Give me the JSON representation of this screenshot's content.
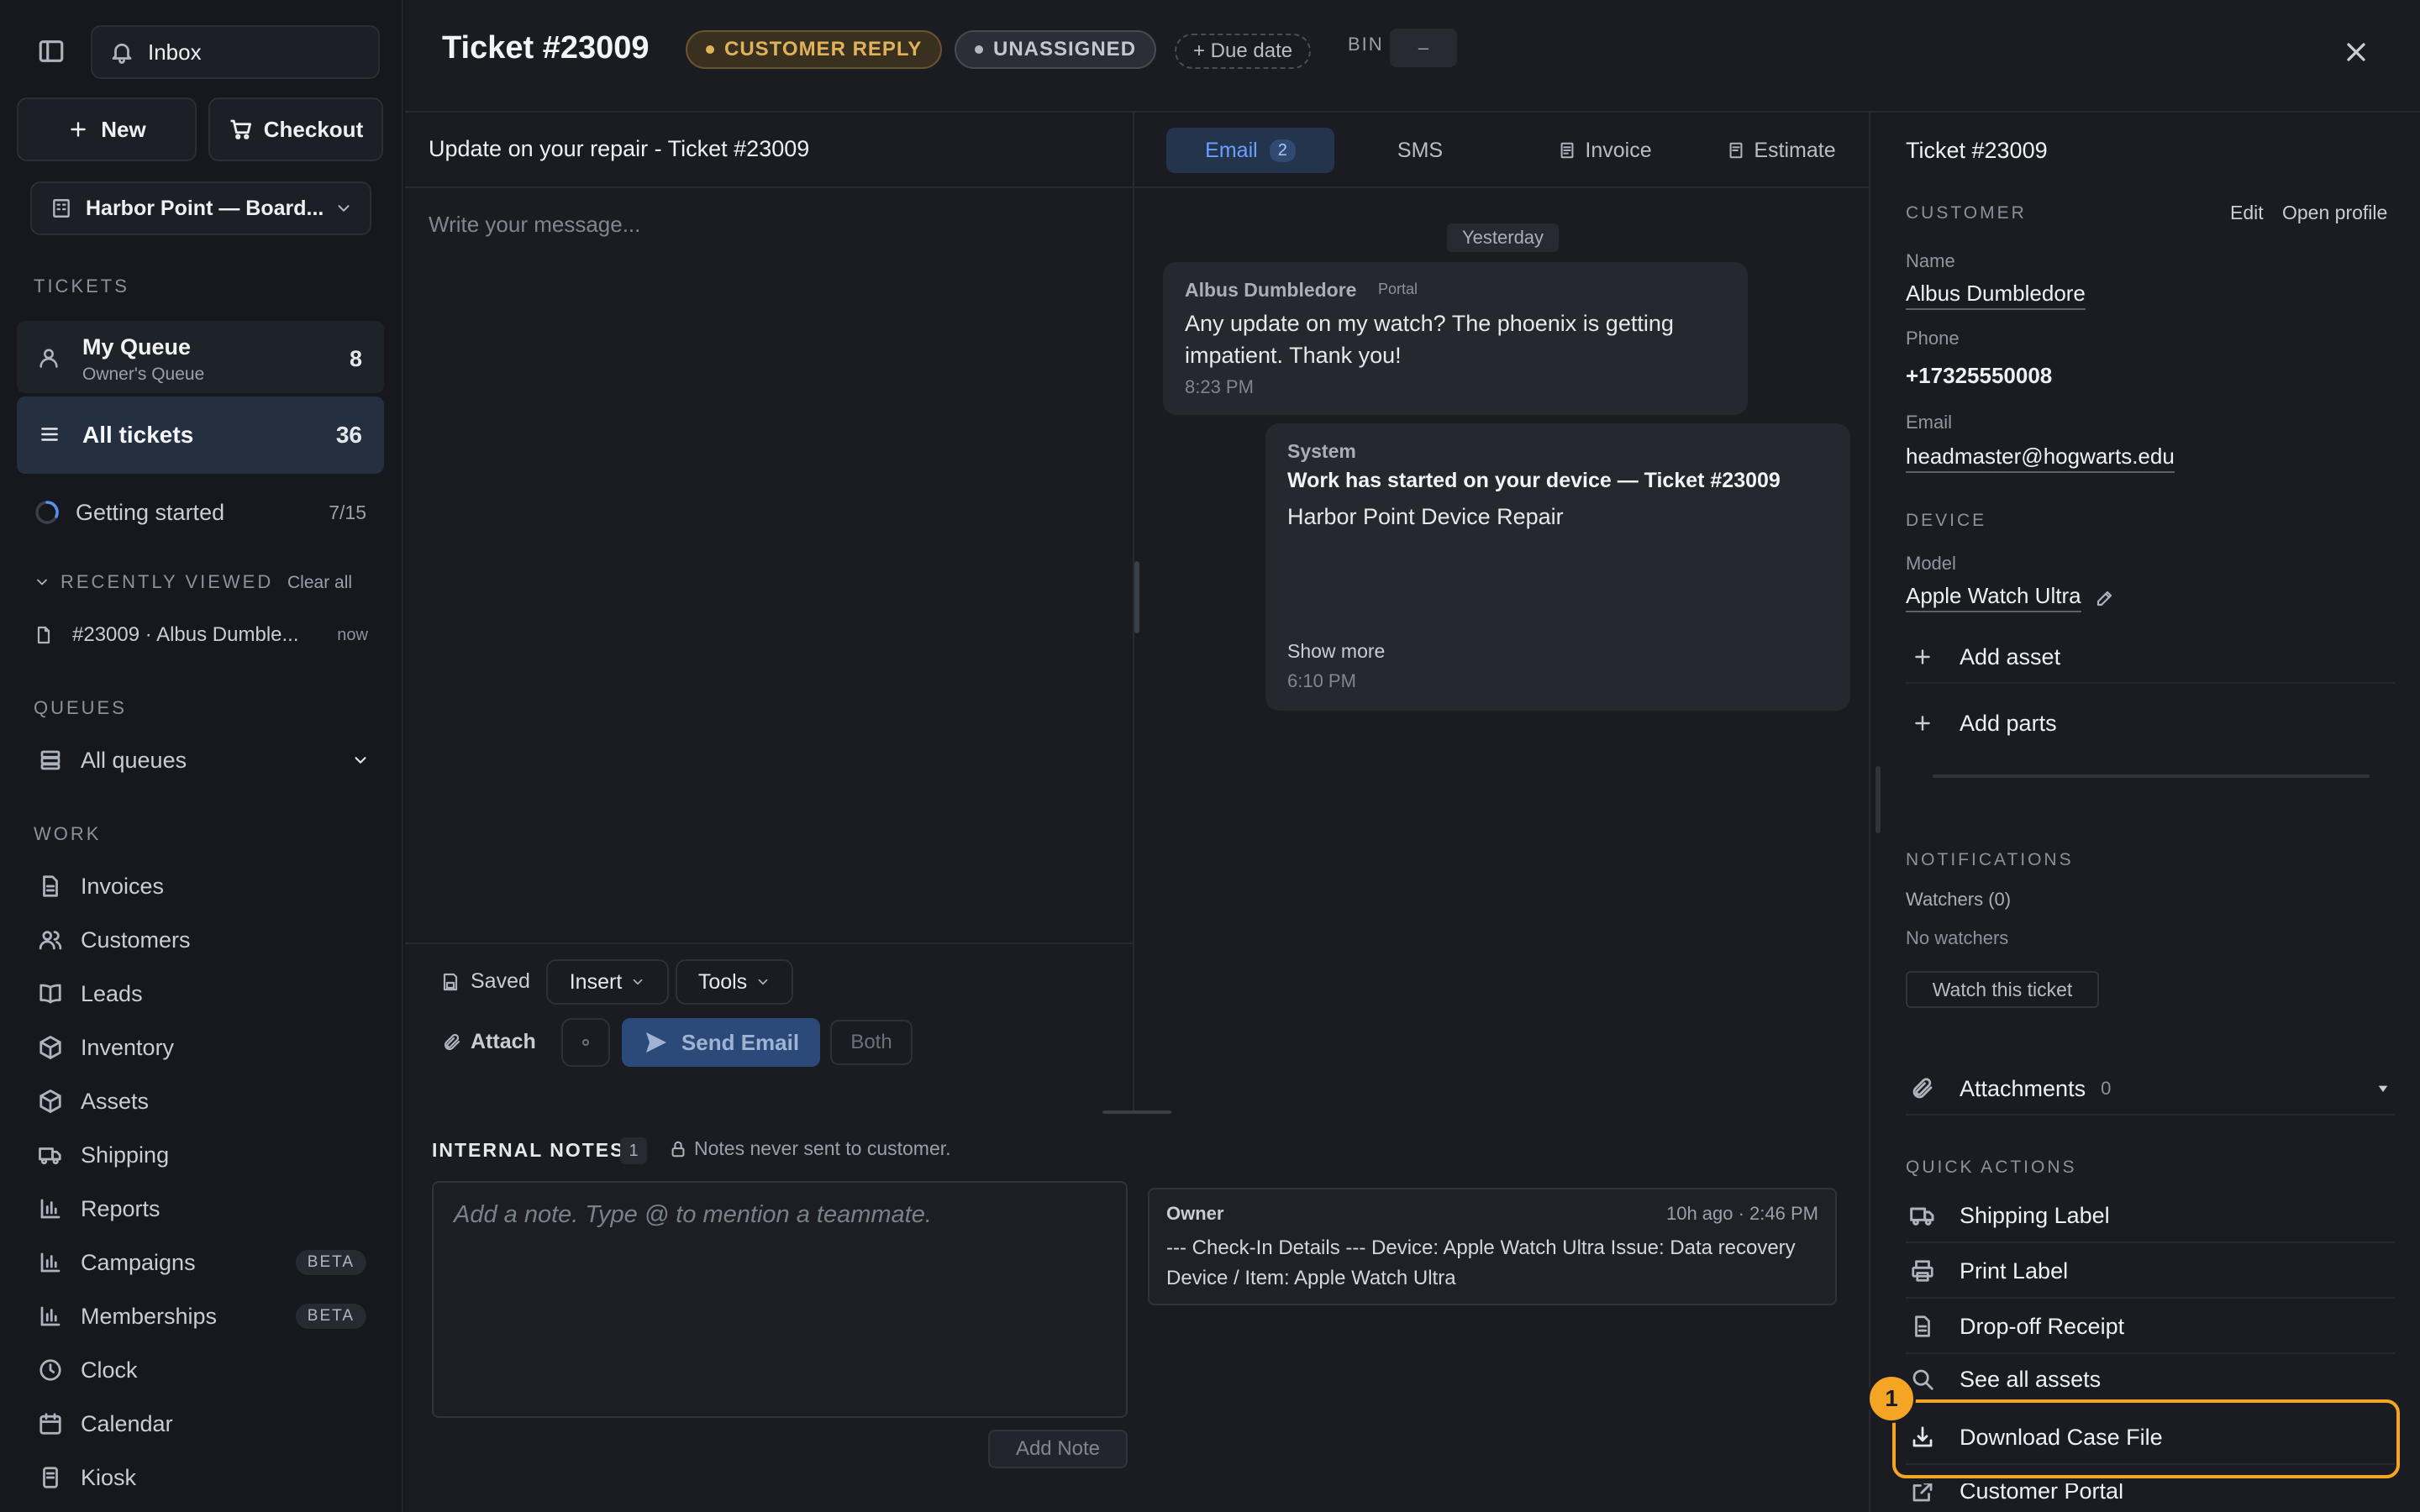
{
  "sidebar": {
    "inbox_label": "Inbox",
    "new_label": "New",
    "checkout_label": "Checkout",
    "location_label": "Harbor Point — Board...",
    "tickets_section": "TICKETS",
    "my_queue_title": "My Queue",
    "my_queue_subtitle": "Owner's Queue",
    "my_queue_count": "8",
    "all_tickets_label": "All tickets",
    "all_tickets_count": "36",
    "getting_started_label": "Getting started",
    "getting_started_progress": "7/15",
    "recently_viewed_section": "RECENTLY VIEWED",
    "clear_all_label": "Clear all",
    "recent_item_label": "#23009 · Albus Dumble...",
    "recent_item_time": "now",
    "queues_section": "QUEUES",
    "all_queues_label": "All queues",
    "work_section": "WORK",
    "work_items": {
      "invoices": "Invoices",
      "customers": "Customers",
      "leads": "Leads",
      "inventory": "Inventory",
      "assets": "Assets",
      "shipping": "Shipping",
      "reports": "Reports",
      "campaigns": "Campaigns",
      "memberships": "Memberships",
      "clock": "Clock",
      "calendar": "Calendar",
      "kiosk": "Kiosk"
    },
    "beta_label": "BETA"
  },
  "header": {
    "ticket_title": "Ticket #23009",
    "status_pill": "CUSTOMER REPLY",
    "assignee_pill": "UNASSIGNED",
    "due_date_label": "+ Due date",
    "bin_label": "BIN",
    "bin_value": "–",
    "close_glyph": "×"
  },
  "composer": {
    "subject": "Update on your repair - Ticket #23009",
    "message_placeholder": "Write your message...",
    "saved_label": "Saved",
    "insert_label": "Insert",
    "tools_label": "Tools",
    "attach_label": "Attach",
    "send_label": "Send Email",
    "both_label": "Both"
  },
  "channels": {
    "email_label": "Email",
    "email_count": "2",
    "sms_label": "SMS",
    "invoice_label": "Invoice",
    "estimate_label": "Estimate"
  },
  "conversation": {
    "date_divider": "Yesterday",
    "customer_msg": {
      "sender": "Albus Dumbledore",
      "source": "Portal",
      "text": "Any update on my watch? The phoenix is getting impatient. Thank you!",
      "time": "8:23 PM"
    },
    "system_msg": {
      "sender": "System",
      "title": "Work has started on your device — Ticket #23009",
      "body": "Harbor Point Device Repair",
      "show_more": "Show more",
      "time": "6:10 PM"
    }
  },
  "notes": {
    "section_label": "INTERNAL NOTES",
    "count": "1",
    "privacy_note": "Notes never sent to customer.",
    "placeholder": "Add a note. Type @ to mention a teammate.",
    "add_note_label": "Add Note",
    "entry": {
      "author": "Owner",
      "time": "10h ago · 2:46 PM",
      "text": "--- Check-In Details --- Device: Apple Watch Ultra Issue: Data recovery Device / Item: Apple Watch Ultra"
    }
  },
  "details": {
    "ticket_label": "Ticket #23009",
    "customer_section": "CUSTOMER",
    "edit_label": "Edit",
    "open_profile_label": "Open profile",
    "name_label": "Name",
    "name_value": "Albus Dumbledore",
    "phone_label": "Phone",
    "phone_value": "+17325550008",
    "email_label": "Email",
    "email_value": "headmaster@hogwarts.edu",
    "device_section": "DEVICE",
    "model_label": "Model",
    "model_value": "Apple Watch Ultra",
    "add_asset_label": "Add asset",
    "add_parts_label": "Add parts",
    "notifications_section": "NOTIFICATIONS",
    "watchers_label": "Watchers (0)",
    "no_watchers_label": "No watchers",
    "watch_button_label": "Watch this ticket",
    "attachments_label": "Attachments",
    "attachments_count": "0",
    "quick_actions_section": "QUICK ACTIONS",
    "quick_actions": {
      "shipping_label": "Shipping Label",
      "print_label": "Print Label",
      "dropoff_receipt": "Drop-off Receipt",
      "see_all_assets": "See all assets",
      "download_case_file": "Download Case File",
      "customer_portal_partial": "Customer Portal"
    },
    "highlight_step": "1"
  },
  "colors": {
    "accent_blue": "#3b82f6",
    "status_amber": "#e0b25a",
    "highlight_orange": "#f5a524"
  }
}
